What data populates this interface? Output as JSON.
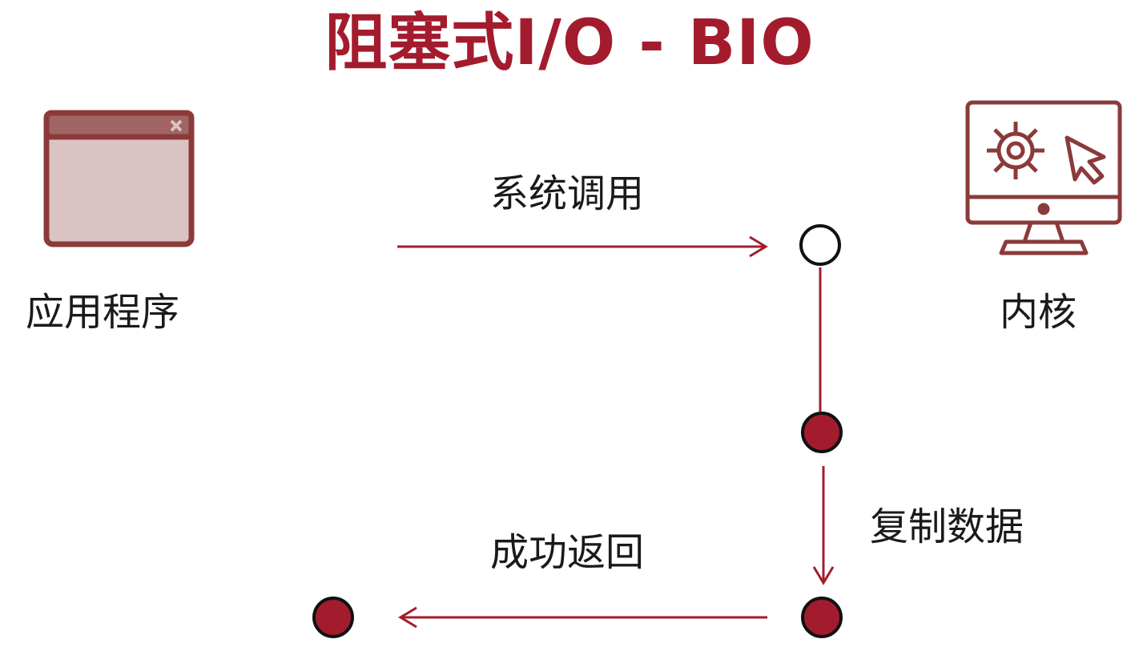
{
  "title": "阻塞式I/O - BIO",
  "nodes": {
    "application": {
      "label": "应用程序",
      "icon": "app-window-icon"
    },
    "kernel": {
      "label": "内核",
      "icon": "monitor-gear-cursor-icon"
    }
  },
  "edges": {
    "system_call": {
      "label": "系统调用"
    },
    "copy_data": {
      "label": "复制数据"
    },
    "success_return": {
      "label": "成功返回"
    }
  },
  "colors": {
    "accent": "#a31c2e",
    "icon_brown": "#8b3a3a",
    "icon_fill": "#dcc3c3",
    "text": "#1a1a1a"
  }
}
